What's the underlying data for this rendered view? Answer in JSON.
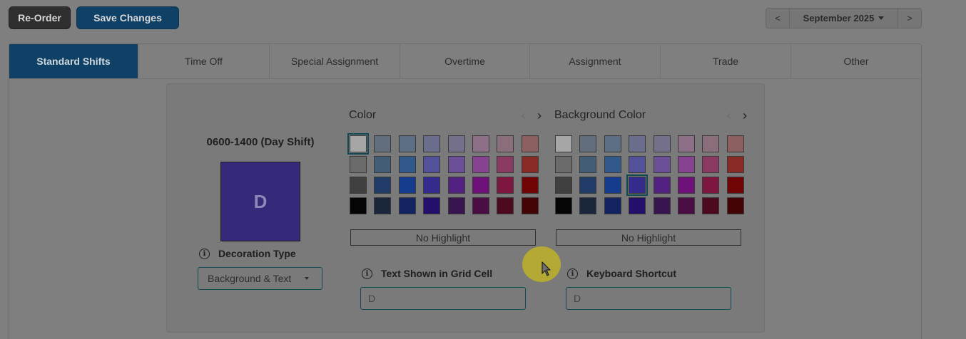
{
  "toolbar": {
    "reorder_label": "Re-Order",
    "save_label": "Save Changes"
  },
  "month_nav": {
    "prev": "<",
    "month": "September 2025",
    "next": ">"
  },
  "tabs": [
    {
      "label": "Standard Shifts",
      "active": true
    },
    {
      "label": "Time Off"
    },
    {
      "label": "Special Assignment"
    },
    {
      "label": "Overtime"
    },
    {
      "label": "Assignment"
    },
    {
      "label": "Trade"
    },
    {
      "label": "Other"
    }
  ],
  "shift": {
    "title": "0600-1400 (Day Shift)",
    "preview_text": "D",
    "preview_color": "#352a7a",
    "decoration_label": "Decoration Type",
    "decoration_value": "Background & Text"
  },
  "color_palette": {
    "title": "Color",
    "no_highlight": "No Highlight",
    "selected_index": 0
  },
  "background_palette": {
    "title": "Background Color",
    "no_highlight": "No Highlight",
    "selected_index": 19
  },
  "swatches": [
    "#a6a6a6",
    "#626e7c",
    "#5d6f85",
    "#6a6e8c",
    "#74708c",
    "#8d6f88",
    "#8a6e7c",
    "#8c5f60",
    "#6b6b6b",
    "#435d76",
    "#31598a",
    "#53519a",
    "#6a4f96",
    "#86438f",
    "#8b3b61",
    "#8a2a26",
    "#404040",
    "#223c6a",
    "#163c8d",
    "#342b8d",
    "#532182",
    "#6e117b",
    "#7d1742",
    "#6f0505",
    "#050505",
    "#1a263b",
    "#142463",
    "#24106b",
    "#38154f",
    "#4a0e44",
    "#4d0a1e",
    "#420404"
  ],
  "grid_text": {
    "label": "Text Shown in Grid Cell",
    "value": "D"
  },
  "shortcut": {
    "label": "Keyboard Shortcut",
    "value": "D"
  },
  "icons": {
    "info": "info-icon",
    "cursor": "mouse-pointer-icon"
  }
}
